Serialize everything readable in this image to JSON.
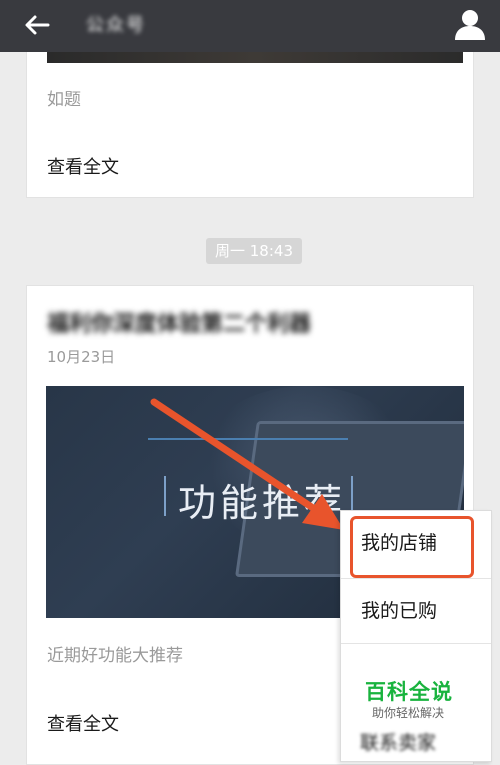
{
  "header": {
    "title": "公众号",
    "back_icon": "back-arrow-icon",
    "user_icon": "user-icon"
  },
  "articles": [
    {
      "summary": "如题",
      "read_more": "查看全文"
    },
    {
      "title": "福利你深度体验第二个利器",
      "date": "10月23日",
      "banner_text": "功能推荐",
      "summary": "近期好功能大推荐",
      "read_more": "查看全文"
    }
  ],
  "timestamp": "周一 18:43",
  "menu": {
    "items": [
      {
        "label": "我的店铺"
      },
      {
        "label": "我的已购"
      },
      {
        "label": "联系卖家"
      }
    ],
    "highlight_color": "#e8542c"
  },
  "watermark": {
    "main": "百科全说",
    "sub": "助你轻松解决",
    "color": "#19b33e"
  },
  "colors": {
    "topbar": "#393a3f",
    "background": "#ececec",
    "arrow": "#e8542c"
  }
}
